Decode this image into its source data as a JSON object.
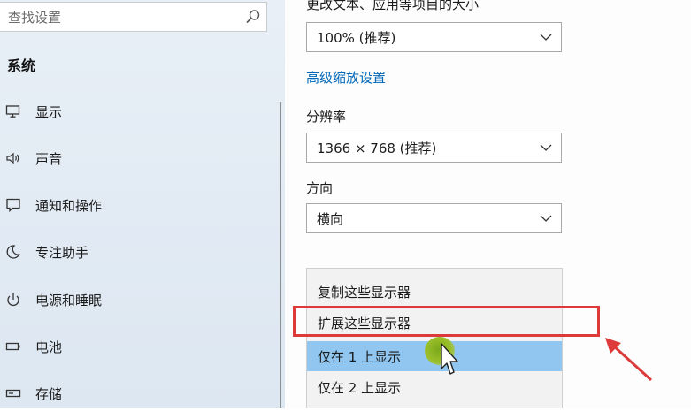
{
  "sidebar": {
    "search_placeholder": "查找设置",
    "section_title": "系统",
    "items": [
      {
        "label": "显示",
        "icon": "monitor-icon"
      },
      {
        "label": "声音",
        "icon": "speaker-icon"
      },
      {
        "label": "通知和操作",
        "icon": "notification-icon"
      },
      {
        "label": "专注助手",
        "icon": "moon-icon"
      },
      {
        "label": "电源和睡眠",
        "icon": "power-icon"
      },
      {
        "label": "电池",
        "icon": "battery-icon"
      },
      {
        "label": "存储",
        "icon": "storage-icon"
      }
    ]
  },
  "main": {
    "scale_label": "更改文本、应用等项目的大小",
    "scale_value": "100% (推荐)",
    "advanced_scaling_link": "高级缩放设置",
    "resolution_label": "分辨率",
    "resolution_value": "1366 × 768 (推荐)",
    "orientation_label": "方向",
    "orientation_value": "横向",
    "multi_display_options": [
      "复制这些显示器",
      "扩展这些显示器",
      "仅在 1 上显示",
      "仅在 2 上显示"
    ],
    "selected_option": "仅在 1 上显示"
  },
  "colors": {
    "accent_link": "#0067b8",
    "selected_bg": "#90c6f0",
    "annotation_red": "#dd3b3b"
  }
}
